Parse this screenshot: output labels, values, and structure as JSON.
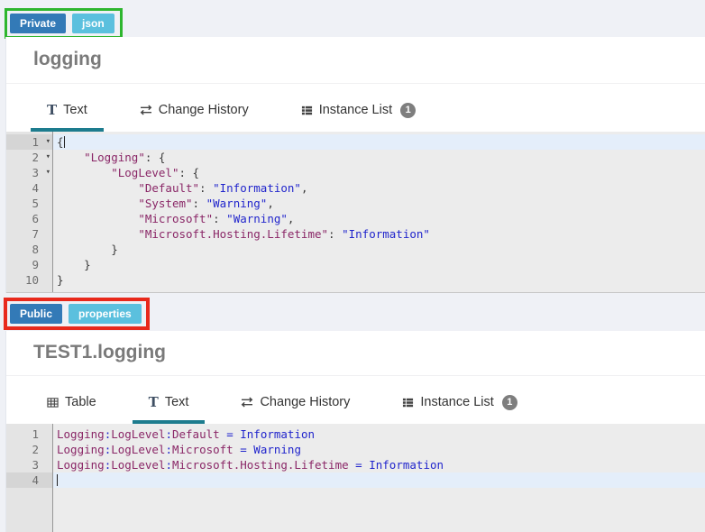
{
  "colors": {
    "page-bg": "#eff1f6",
    "panel-bg": "#ffffff",
    "panel-border": "#e4e7ed",
    "divider": "#f0f0f2",
    "accent-teal": "#1d7c8e",
    "tab-text": "#333333",
    "badge-private-bg": "#337ab7",
    "badge-format-bg": "#5bc0de",
    "anno-green": "#2eb62e",
    "anno-red": "#e8291c",
    "editor-bg": "#ececec",
    "gutter-bg": "#e4e4e4",
    "gutter-line": "#969696",
    "gutter-text": "#6e6e6e",
    "active-line-bg": "#e4eefa",
    "active-gutter-bg": "#d5d5d5",
    "tok-key": "#8a2767",
    "tok-val": "#2125cc",
    "tok-punct": "#3a3a3a",
    "count-badge-bg": "#7e7e7e",
    "title-color": "#7a7a7a"
  },
  "icons": {
    "text_glyph": "T"
  },
  "panels": [
    {
      "badges": [
        {
          "label": "Private"
        },
        {
          "label": "json"
        }
      ],
      "title": "logging",
      "tabs": [
        {
          "label": "Text"
        },
        {
          "label": "Change History"
        },
        {
          "label": "Instance List",
          "count": "1"
        }
      ],
      "editor": {
        "lines": [
          {
            "n": 1,
            "fold": true,
            "active": true,
            "cursor": "end",
            "tokens": [
              [
                "p",
                "{"
              ]
            ]
          },
          {
            "n": 2,
            "fold": true,
            "tokens": [
              [
                "w",
                "    "
              ],
              [
                "k",
                "\"Logging\""
              ],
              [
                "p",
                ": {"
              ]
            ]
          },
          {
            "n": 3,
            "fold": true,
            "tokens": [
              [
                "w",
                "        "
              ],
              [
                "k",
                "\"LogLevel\""
              ],
              [
                "p",
                ": {"
              ]
            ]
          },
          {
            "n": 4,
            "tokens": [
              [
                "w",
                "            "
              ],
              [
                "k",
                "\"Default\""
              ],
              [
                "p",
                ": "
              ],
              [
                "v",
                "\"Information\""
              ],
              [
                "p",
                ","
              ]
            ]
          },
          {
            "n": 5,
            "tokens": [
              [
                "w",
                "            "
              ],
              [
                "k",
                "\"System\""
              ],
              [
                "p",
                ": "
              ],
              [
                "v",
                "\"Warning\""
              ],
              [
                "p",
                ","
              ]
            ]
          },
          {
            "n": 6,
            "tokens": [
              [
                "w",
                "            "
              ],
              [
                "k",
                "\"Microsoft\""
              ],
              [
                "p",
                ": "
              ],
              [
                "v",
                "\"Warning\""
              ],
              [
                "p",
                ","
              ]
            ]
          },
          {
            "n": 7,
            "tokens": [
              [
                "w",
                "            "
              ],
              [
                "k",
                "\"Microsoft.Hosting.Lifetime\""
              ],
              [
                "p",
                ": "
              ],
              [
                "v",
                "\"Information\""
              ]
            ]
          },
          {
            "n": 8,
            "tokens": [
              [
                "w",
                "        "
              ],
              [
                "p",
                "}"
              ]
            ]
          },
          {
            "n": 9,
            "tokens": [
              [
                "w",
                "    "
              ],
              [
                "p",
                "}"
              ]
            ]
          },
          {
            "n": 10,
            "tokens": [
              [
                "p",
                "}"
              ]
            ]
          }
        ]
      }
    },
    {
      "badges": [
        {
          "label": "Public"
        },
        {
          "label": "properties"
        }
      ],
      "title": "TEST1.logging",
      "tabs": [
        {
          "label": "Table"
        },
        {
          "label": "Text"
        },
        {
          "label": "Change History"
        },
        {
          "label": "Instance List",
          "count": "1"
        }
      ],
      "editor": {
        "lines": [
          {
            "n": 1,
            "tokens": [
              [
                "k",
                "Logging"
              ],
              [
                "o",
                ":"
              ],
              [
                "k",
                "LogLevel"
              ],
              [
                "o",
                ":"
              ],
              [
                "k",
                "Default"
              ],
              [
                "w",
                " "
              ],
              [
                "o",
                "="
              ],
              [
                "w",
                " "
              ],
              [
                "v",
                "Information"
              ]
            ]
          },
          {
            "n": 2,
            "tokens": [
              [
                "k",
                "Logging"
              ],
              [
                "o",
                ":"
              ],
              [
                "k",
                "LogLevel"
              ],
              [
                "o",
                ":"
              ],
              [
                "k",
                "Microsoft"
              ],
              [
                "w",
                " "
              ],
              [
                "o",
                "="
              ],
              [
                "w",
                " "
              ],
              [
                "v",
                "Warning"
              ]
            ]
          },
          {
            "n": 3,
            "tokens": [
              [
                "k",
                "Logging"
              ],
              [
                "o",
                ":"
              ],
              [
                "k",
                "LogLevel"
              ],
              [
                "o",
                ":"
              ],
              [
                "k",
                "Microsoft.Hosting.Lifetime"
              ],
              [
                "w",
                " "
              ],
              [
                "o",
                "="
              ],
              [
                "w",
                " "
              ],
              [
                "v",
                "Information"
              ]
            ]
          },
          {
            "n": 4,
            "active": true,
            "cursor": "start",
            "tokens": []
          }
        ]
      }
    }
  ]
}
